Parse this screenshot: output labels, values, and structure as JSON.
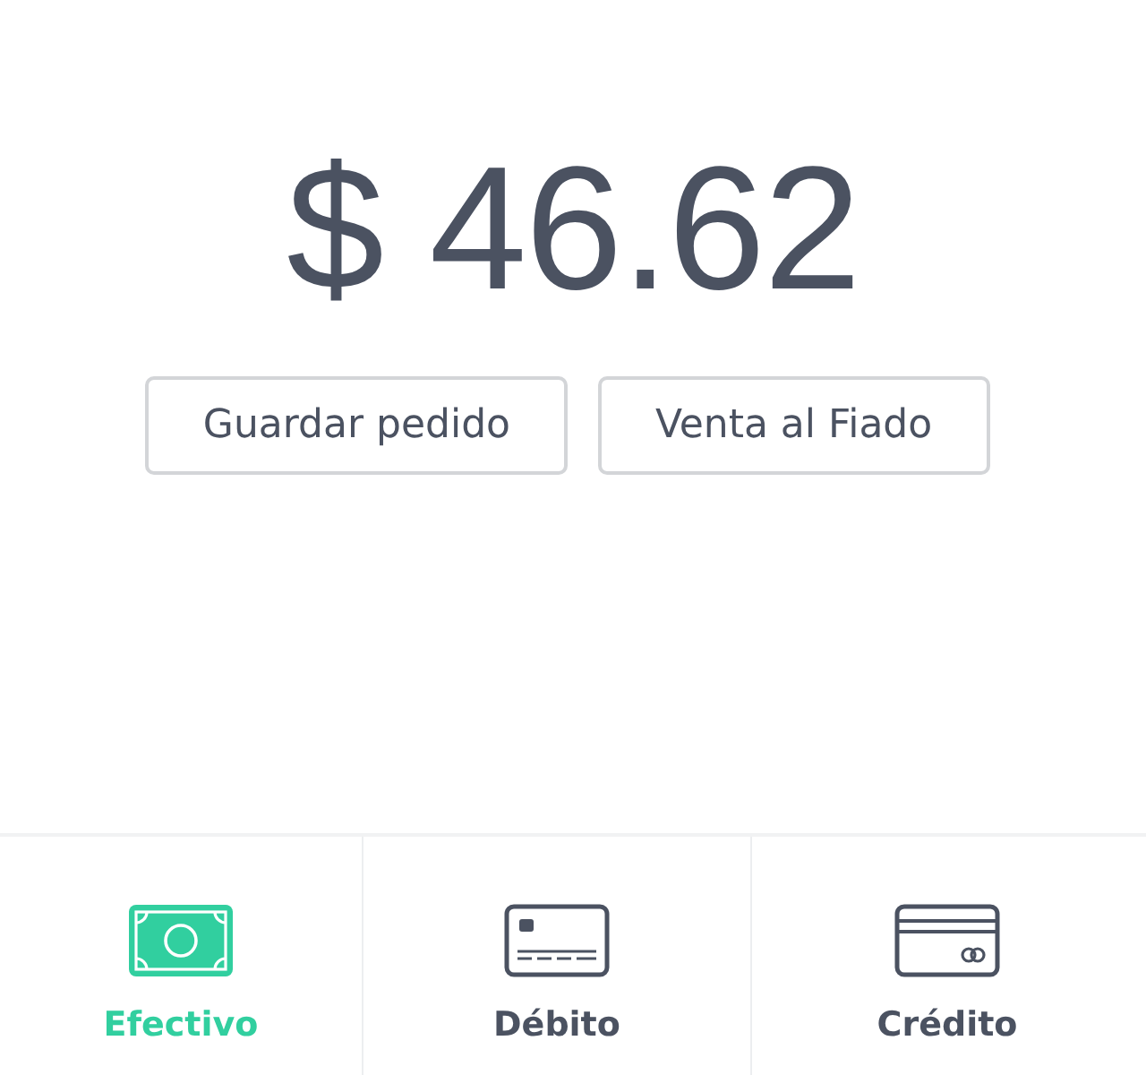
{
  "amount": "$ 46.62",
  "buttons": [
    {
      "label": "Guardar pedido"
    },
    {
      "label": "Venta al Fiado"
    }
  ],
  "payment_tabs": [
    {
      "kind": "cash",
      "label": "Efectivo",
      "selected": true
    },
    {
      "kind": "debit",
      "label": "Débito",
      "selected": false
    },
    {
      "kind": "credit",
      "label": "Crédito",
      "selected": false
    }
  ]
}
